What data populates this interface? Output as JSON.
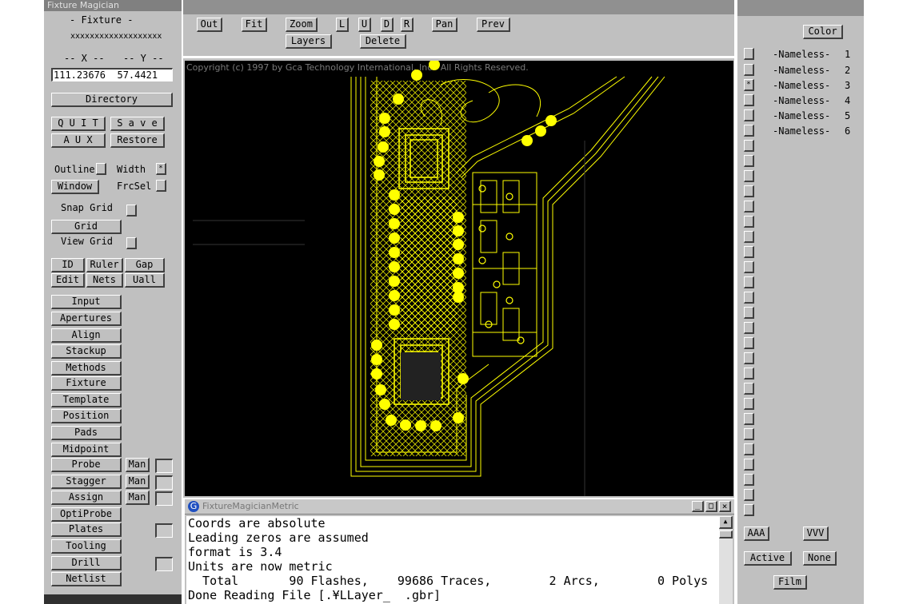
{
  "app": {
    "title": "Fixture Magician",
    "mode_label": "- Fixture -",
    "filename_mask": "xxxxxxxxxxxxxxxxxxx",
    "x_label": "-- X --",
    "y_label": "-- Y --",
    "coords": "111.23676  57.4421"
  },
  "left_buttons": {
    "directory": "Directory",
    "quit": "Q U I T",
    "save": "S a v e",
    "aux": "A U X",
    "restore": "Restore",
    "outline": "Outline",
    "width": "Width",
    "width_check": "*",
    "window": "Window",
    "frcsel": "FrcSel",
    "snap_grid": "Snap Grid",
    "grid": "Grid",
    "view_grid": "View Grid",
    "id": "ID",
    "ruler": "Ruler",
    "gap": "Gap",
    "edit": "Edit",
    "nets": "Nets",
    "uall": "Uall",
    "menu": [
      "Input",
      "Apertures",
      "Align",
      "Stackup",
      "Methods",
      "Fixture",
      "Template",
      "Position",
      "Pads",
      "Midpoint"
    ],
    "probe": "Probe",
    "stagger": "Stagger",
    "assign": "Assign",
    "man": "Man",
    "optiprobe": "OptiProbe",
    "plates": "Plates",
    "tooling": "Tooling",
    "drill": "Drill",
    "netlist": "Netlist"
  },
  "toolbar": {
    "out": "Out",
    "fit": "Fit",
    "zoom": "Zoom",
    "l": "L",
    "u": "U",
    "d": "D",
    "r": "R",
    "pan": "Pan",
    "prev": "Prev",
    "layers": "Layers",
    "delete": "Delete"
  },
  "canvas": {
    "copyright": "Copyright (c) 1997 by Gca Technology International, Inc.  All Rights Reserved."
  },
  "right_panel": {
    "color": "Color",
    "selected_marker": "*",
    "layers": [
      {
        "name": "-Nameless-",
        "num": "1"
      },
      {
        "name": "-Nameless-",
        "num": "2"
      },
      {
        "name": "-Nameless-",
        "num": "3"
      },
      {
        "name": "-Nameless-",
        "num": "4"
      },
      {
        "name": "-Nameless-",
        "num": "5"
      },
      {
        "name": "-Nameless-",
        "num": "6"
      }
    ],
    "aaa": "AAA",
    "vvv": "VVV",
    "active": "Active",
    "none": "None",
    "film": "Film"
  },
  "console": {
    "title": "FixtureMagicianMetric",
    "lines": [
      "Coords are absolute",
      "Leading zeros are assumed",
      "format is 3.4",
      "Units are now metric",
      "  Total       90 Flashes,    99686 Traces,        2 Arcs,        0 Polys",
      "Done Reading File [.¥LLayer_  .gbr]"
    ]
  },
  "colors": {
    "pcb_trace": "#ffff00",
    "canvas_bg": "#000000",
    "panel": "#c0c0c0"
  }
}
